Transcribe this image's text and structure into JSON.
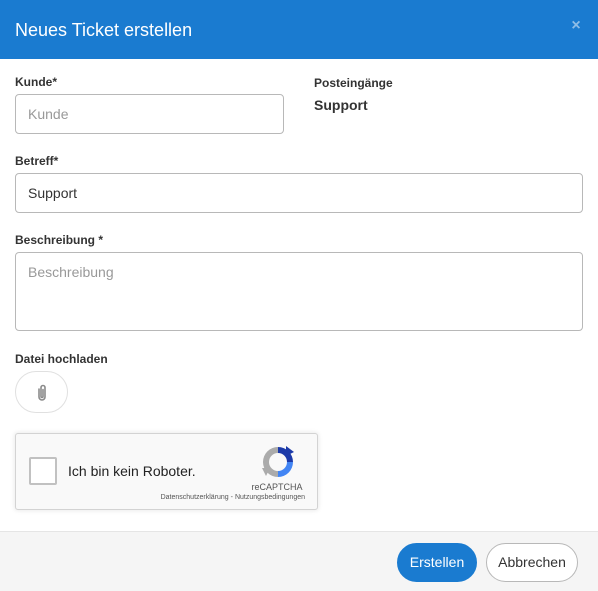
{
  "header": {
    "title": "Neues Ticket erstellen",
    "close_label": "×"
  },
  "form": {
    "customer": {
      "label": "Kunde*",
      "placeholder": "Kunde",
      "value": ""
    },
    "inboxes": {
      "label": "Posteingänge",
      "value": "Support"
    },
    "subject": {
      "label": "Betreff*",
      "value": "Support"
    },
    "description": {
      "label": "Beschreibung *",
      "placeholder": "Beschreibung",
      "value": ""
    },
    "upload": {
      "label": "Datei hochladen",
      "icon": "paperclip-icon"
    }
  },
  "recaptcha": {
    "label": "Ich bin kein Roboter.",
    "brand": "reCAPTCHA",
    "privacy_link": "Datenschutzerklärung",
    "separator": " - ",
    "terms_link": "Nutzungsbedingungen",
    "checked": false
  },
  "footer": {
    "create_label": "Erstellen",
    "cancel_label": "Abbrechen"
  },
  "colors": {
    "header_bg": "#1a7bd0",
    "primary_button": "#1a7bd0",
    "footer_bg": "#f5f5f5"
  }
}
